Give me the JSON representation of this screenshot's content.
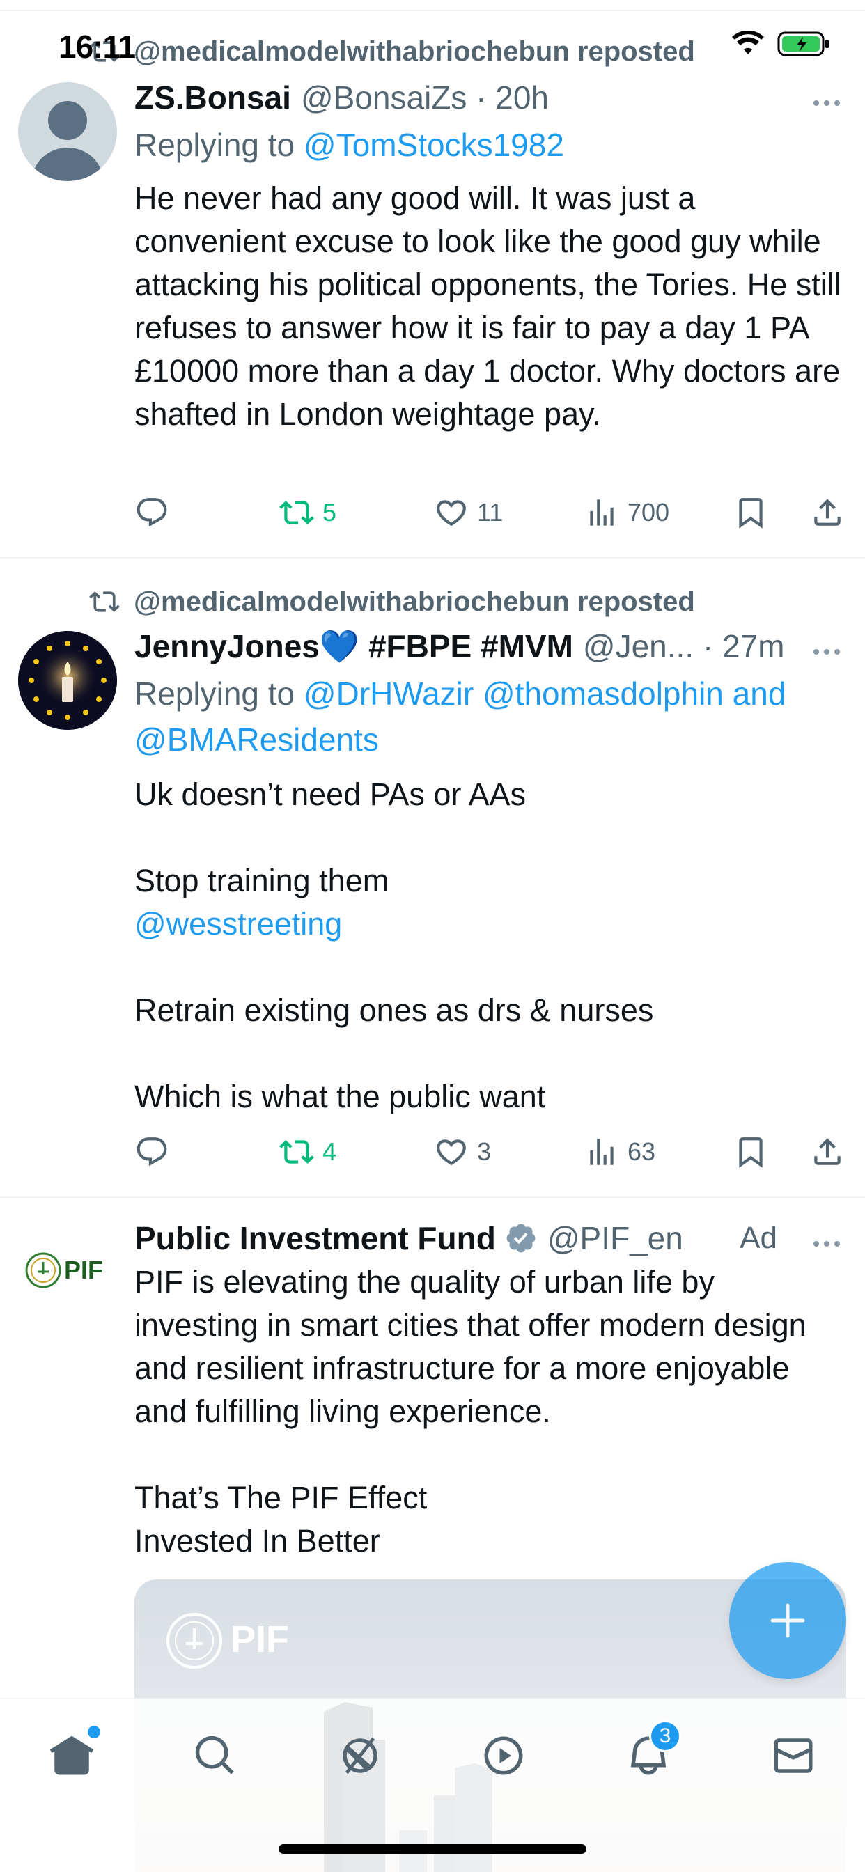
{
  "status_bar": {
    "time": "16:11"
  },
  "posts": [
    {
      "reposted_by": "@medicalmodelwithabriochebun reposted",
      "display_name": "ZS.Bonsai",
      "handle_time": "@BonsaiZs · 20h",
      "reply_prefix": "Replying to",
      "reply_mentions": "@TomStocks1982",
      "text": "He never had any good will. It was just a convenient excuse to look like the good guy while attacking his political opponents, the Tories. He still refuses to answer how it is fair to pay a day 1 PA £10000 more than a day 1 doctor. Why doctors are shafted in London weightage pay.",
      "retweets": "5",
      "likes": "11",
      "views": "700"
    },
    {
      "reposted_by": "@medicalmodelwithabriochebun reposted",
      "display_name": "JennyJones💙 #FBPE #MVM",
      "handle_time": "@Jen... · 27m",
      "reply_prefix": "Replying to",
      "reply_mentions": "@DrHWazir @thomasdolphin and @BMAResidents",
      "text_1": "Uk doesn’t need PAs or AAs\n\nStop training them",
      "text_mention": "@wesstreeting",
      "text_2": "\nRetrain existing ones as drs & nurses\n\nWhich is what the public want",
      "retweets": "4",
      "likes": "3",
      "views": "63"
    },
    {
      "display_name": "Public Investment Fund",
      "handle": "@PIF_en",
      "ad_label": "Ad",
      "text": "PIF is elevating the quality of urban life by investing in smart cities that offer modern design and resilient infrastructure for a more enjoyable and fulfilling living experience.\n\nThat’s The PIF Effect\nInvested In Better",
      "logo_text": "PIF"
    }
  ],
  "tab_bar": {
    "items": [
      "home-icon",
      "search-icon",
      "grok-icon",
      "video-icon",
      "notifications-icon",
      "messages-icon"
    ],
    "notifications_badge": "3"
  },
  "colors": {
    "accent": "#1d9bf0",
    "repost_green": "#00ba7c",
    "secondary_text": "#536471"
  }
}
